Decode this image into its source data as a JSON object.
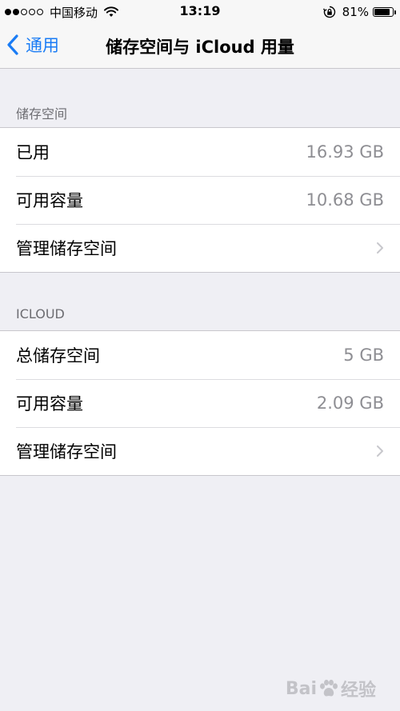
{
  "status_bar": {
    "carrier": "中国移动",
    "time": "13:19",
    "battery": "81%",
    "signal_strength": "2 of 5"
  },
  "nav": {
    "back_label": "通用",
    "title": "储存空间与 iCloud 用量"
  },
  "storage_section": {
    "header": "储存空间",
    "rows": [
      {
        "label": "已用",
        "value": "16.93 GB"
      },
      {
        "label": "可用容量",
        "value": "10.68 GB"
      },
      {
        "label": "管理储存空间"
      }
    ]
  },
  "icloud_section": {
    "header": "ICLOUD",
    "rows": [
      {
        "label": "总储存空间",
        "value": "5 GB"
      },
      {
        "label": "可用容量",
        "value": "2.09 GB"
      },
      {
        "label": "管理储存空间"
      }
    ]
  },
  "watermark": {
    "text_left": "Bai",
    "text_right": "经验"
  },
  "colors": {
    "accent": "#1a7cf5",
    "background": "#efeff4",
    "secondary_text": "#8e8e93",
    "separator": "#c8c7cc"
  }
}
